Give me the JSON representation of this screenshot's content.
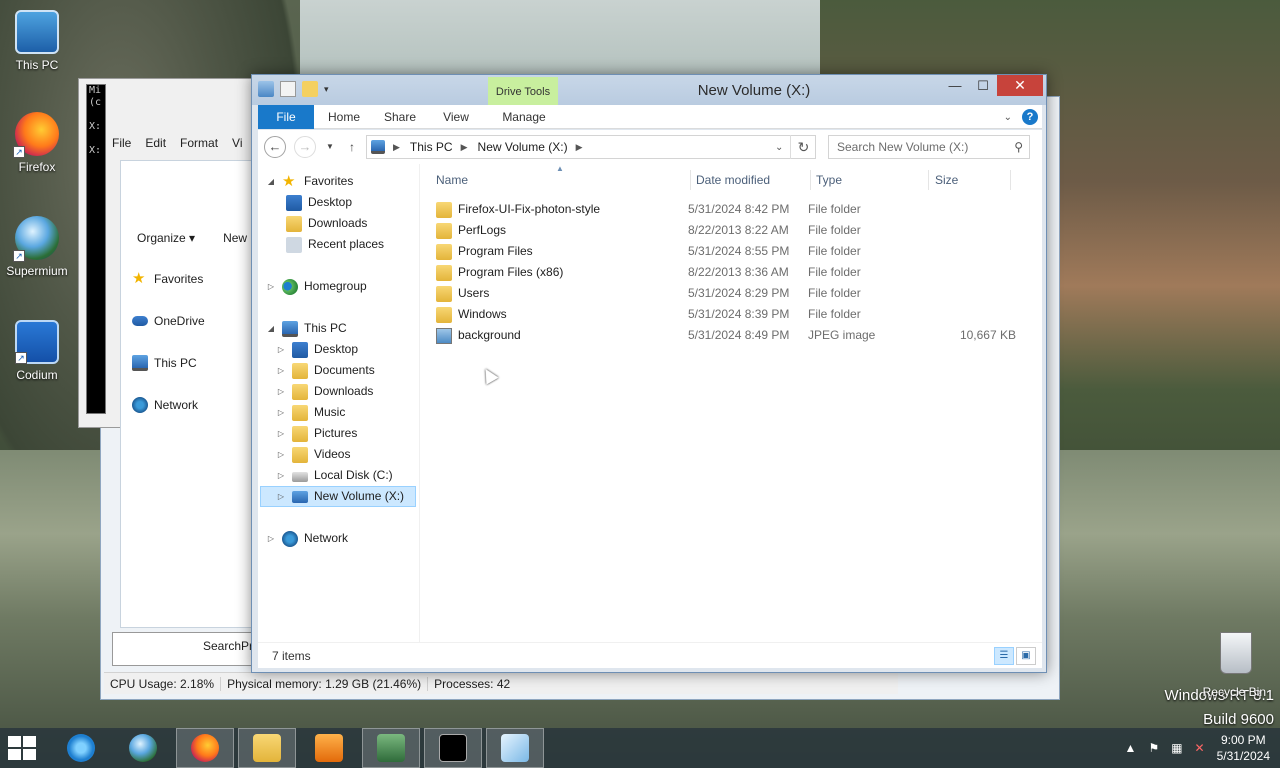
{
  "desktop": {
    "icons": [
      {
        "label": "This PC",
        "icon": "this-pc-icon"
      },
      {
        "label": "Firefox",
        "icon": "firefox-icon"
      },
      {
        "label": "Supermium",
        "icon": "supermium-icon"
      },
      {
        "label": "Codium",
        "icon": "codium-icon"
      }
    ],
    "recycle_bin": "Recycle Bin",
    "watermark_line1": "Windows RT 8.1",
    "watermark_line2": "Build 9600"
  },
  "background_windows": {
    "cmd_lines": [
      "Mi",
      "(c",
      "",
      "X:",
      "",
      "X:"
    ],
    "notepad_menu": [
      "File",
      "Edit",
      "Format",
      "Vi"
    ],
    "explorer2": {
      "organize": "Organize",
      "new": "New",
      "items": [
        "Favorites",
        "OneDrive",
        "This PC",
        "Network"
      ]
    },
    "taskmgr_list_item": "SearchPr",
    "taskmgr_status": {
      "cpu": "CPU Usage: 2.18%",
      "memory": "Physical memory: 1.29 GB (21.46%)",
      "processes": "Processes: 42"
    }
  },
  "window": {
    "title": "New Volume (X:)",
    "contextual_tab": "Drive Tools",
    "controls": {
      "minimize": "—",
      "maximize": "☐",
      "close": "✕"
    },
    "ribbon_tabs": [
      "File",
      "Home",
      "Share",
      "View",
      "Manage"
    ],
    "address": {
      "crumbs": [
        "This PC",
        "New Volume (X:)"
      ],
      "search_placeholder": "Search New Volume (X:)"
    },
    "nav": {
      "favorites": "Favorites",
      "favorites_items": [
        "Desktop",
        "Downloads",
        "Recent places"
      ],
      "homegroup": "Homegroup",
      "this_pc": "This PC",
      "this_pc_items": [
        "Desktop",
        "Documents",
        "Downloads",
        "Music",
        "Pictures",
        "Videos",
        "Local Disk (C:)",
        "New Volume (X:)"
      ],
      "network": "Network"
    },
    "columns": {
      "name": "Name",
      "date": "Date modified",
      "type": "Type",
      "size": "Size"
    },
    "files": [
      {
        "name": "Firefox-UI-Fix-photon-style",
        "date": "5/31/2024 8:42 PM",
        "type": "File folder",
        "size": "",
        "icon": "folder"
      },
      {
        "name": "PerfLogs",
        "date": "8/22/2013 8:22 AM",
        "type": "File folder",
        "size": "",
        "icon": "folder"
      },
      {
        "name": "Program Files",
        "date": "5/31/2024 8:55 PM",
        "type": "File folder",
        "size": "",
        "icon": "folder"
      },
      {
        "name": "Program Files (x86)",
        "date": "8/22/2013 8:36 AM",
        "type": "File folder",
        "size": "",
        "icon": "folder"
      },
      {
        "name": "Users",
        "date": "5/31/2024 8:29 PM",
        "type": "File folder",
        "size": "",
        "icon": "folder"
      },
      {
        "name": "Windows",
        "date": "5/31/2024 8:39 PM",
        "type": "File folder",
        "size": "",
        "icon": "folder"
      },
      {
        "name": "background",
        "date": "5/31/2024 8:49 PM",
        "type": "JPEG image",
        "size": "10,667 KB",
        "icon": "image"
      }
    ],
    "status": "7 items"
  },
  "taskbar": {
    "time": "9:00 PM",
    "date": "5/31/2024",
    "apps": [
      "internet-explorer-icon",
      "supermium-icon",
      "firefox-icon",
      "file-explorer-icon",
      "media-player-icon",
      "task-manager-icon",
      "command-prompt-icon",
      "notepad-icon"
    ]
  }
}
